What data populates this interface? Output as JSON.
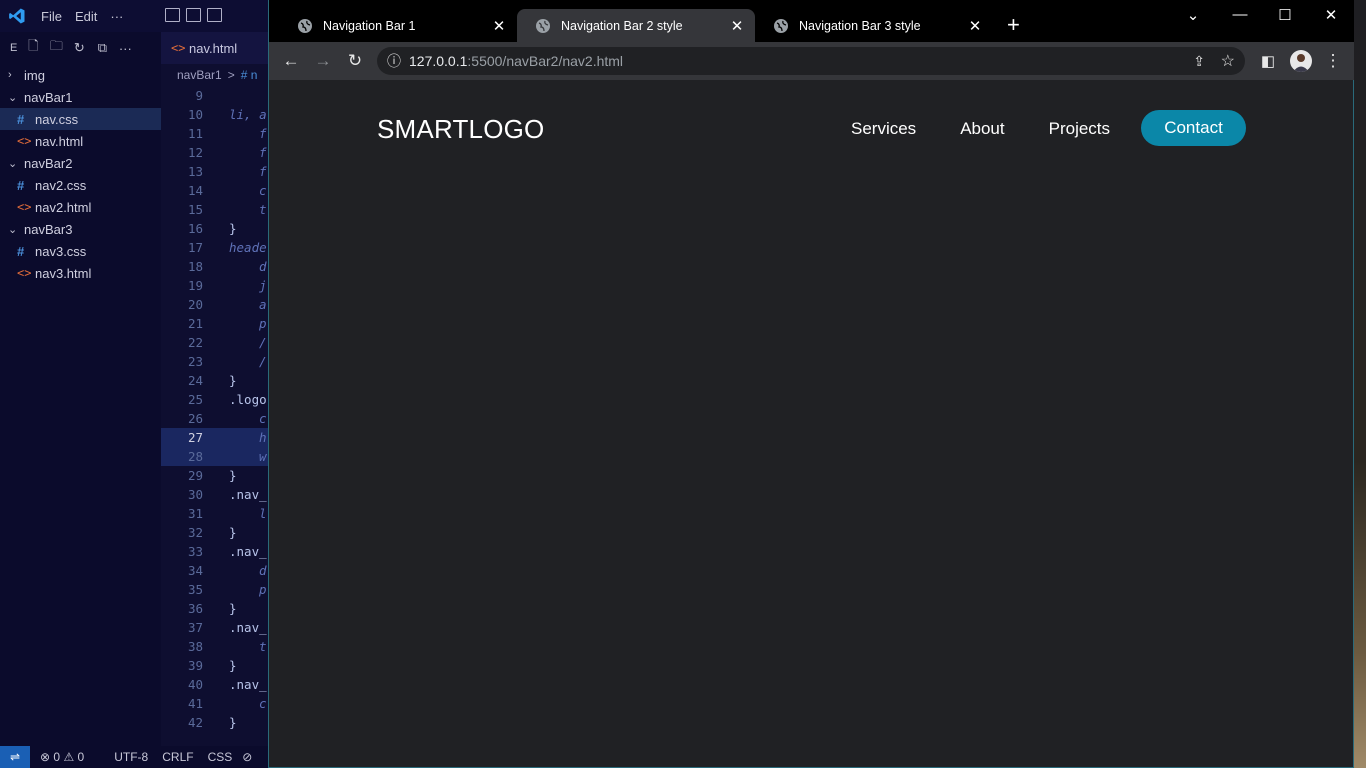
{
  "vscode": {
    "menu": [
      "File",
      "Edit",
      "···"
    ],
    "explorer": {
      "label": "E",
      "tree": [
        {
          "type": "folder",
          "name": "img",
          "open": false
        },
        {
          "type": "folder",
          "name": "navBar1",
          "open": true
        },
        {
          "type": "css",
          "name": "nav.css",
          "active": true
        },
        {
          "type": "html",
          "name": "nav.html"
        },
        {
          "type": "folder",
          "name": "navBar2",
          "open": true
        },
        {
          "type": "css",
          "name": "nav2.css"
        },
        {
          "type": "html",
          "name": "nav2.html"
        },
        {
          "type": "folder",
          "name": "navBar3",
          "open": true
        },
        {
          "type": "css",
          "name": "nav3.css"
        },
        {
          "type": "html",
          "name": "nav3.html"
        }
      ]
    },
    "editor_tab": "nav.html",
    "breadcrumb": {
      "folder": "navBar1",
      "sep": ">",
      "file_prefix": "# n"
    },
    "code": [
      {
        "n": "9",
        "t": "",
        "style": "normal"
      },
      {
        "n": "10",
        "t": "li, a",
        "style": "italic",
        "indent": 0
      },
      {
        "n": "11",
        "t": "f",
        "indent": 1
      },
      {
        "n": "12",
        "t": "f",
        "indent": 1
      },
      {
        "n": "13",
        "t": "f",
        "indent": 1
      },
      {
        "n": "14",
        "t": "c",
        "indent": 1
      },
      {
        "n": "15",
        "t": "t",
        "indent": 1
      },
      {
        "n": "16",
        "t": "}",
        "style": "normal",
        "indent": 0
      },
      {
        "n": "17",
        "t": "heade",
        "indent": 0
      },
      {
        "n": "18",
        "t": "d",
        "indent": 1
      },
      {
        "n": "19",
        "t": "j",
        "indent": 1
      },
      {
        "n": "20",
        "t": "a",
        "indent": 1
      },
      {
        "n": "21",
        "t": "p",
        "indent": 1
      },
      {
        "n": "22",
        "t": "/",
        "indent": 1
      },
      {
        "n": "23",
        "t": "/",
        "indent": 1
      },
      {
        "n": "24",
        "t": "}",
        "style": "normal",
        "indent": 0
      },
      {
        "n": "25",
        "t": ".logo",
        "style": "normal",
        "indent": 0
      },
      {
        "n": "26",
        "t": "c",
        "indent": 1
      },
      {
        "n": "27",
        "t": "h",
        "indent": 1,
        "hl": true,
        "cur": true
      },
      {
        "n": "28",
        "t": "w",
        "indent": 1,
        "hl": true
      },
      {
        "n": "29",
        "t": "}",
        "style": "normal",
        "indent": 0
      },
      {
        "n": "30",
        "t": ".nav_",
        "style": "normal",
        "indent": 0
      },
      {
        "n": "31",
        "t": "l",
        "indent": 1
      },
      {
        "n": "32",
        "t": "}",
        "style": "normal",
        "indent": 0
      },
      {
        "n": "33",
        "t": ".nav_",
        "style": "normal",
        "indent": 0
      },
      {
        "n": "34",
        "t": "d",
        "indent": 1
      },
      {
        "n": "35",
        "t": "p",
        "indent": 1
      },
      {
        "n": "36",
        "t": "}",
        "style": "normal",
        "indent": 0
      },
      {
        "n": "37",
        "t": ".nav_",
        "style": "normal",
        "indent": 0
      },
      {
        "n": "38",
        "t": "t",
        "indent": 1
      },
      {
        "n": "39",
        "t": "}",
        "style": "normal",
        "indent": 0
      },
      {
        "n": "40",
        "t": ".nav_",
        "style": "normal",
        "indent": 0
      },
      {
        "n": "41",
        "t": "c",
        "indent": 1
      },
      {
        "n": "42",
        "t": "}",
        "style": "normal",
        "indent": 0
      }
    ],
    "status": {
      "errors": "0",
      "warnings": "0",
      "encoding": "UTF-8",
      "eol": "CRLF",
      "language": "CSS"
    }
  },
  "browser": {
    "tabs": [
      {
        "title": "Navigation Bar 1",
        "active": false
      },
      {
        "title": "Navigation Bar 2 style",
        "active": true
      },
      {
        "title": "Navigation Bar 3 style",
        "active": false
      }
    ],
    "url": {
      "host": "127.0.0.1",
      "path": ":5500/navBar2/nav2.html"
    },
    "accent": "#0b87a8"
  },
  "site": {
    "logo": "SMARTLOGO",
    "nav": [
      "Services",
      "About",
      "Projects"
    ],
    "cta": "Contact"
  }
}
